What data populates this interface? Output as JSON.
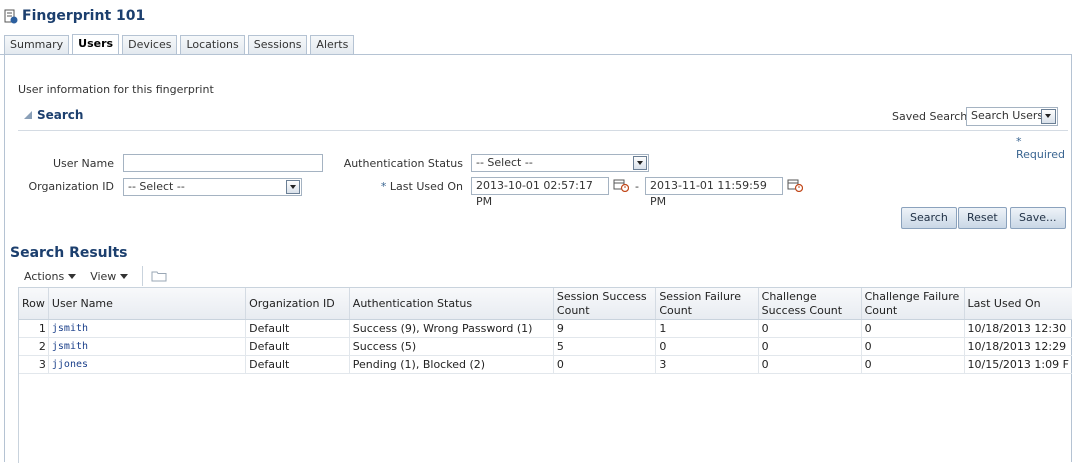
{
  "title": "Fingerprint 101",
  "tabs": [
    {
      "label": "Summary"
    },
    {
      "label": "Users"
    },
    {
      "label": "Devices"
    },
    {
      "label": "Locations"
    },
    {
      "label": "Sessions"
    },
    {
      "label": "Alerts"
    }
  ],
  "active_tab": "Users",
  "intro": "User information for this fingerprint",
  "search": {
    "heading": "Search",
    "saved_search_label": "Saved Search",
    "saved_search_value": "Search Users",
    "required_star": "*",
    "required_label": "Required",
    "user_name_label": "User Name",
    "user_name_value": "",
    "org_id_label": "Organization ID",
    "org_id_value": "-- Select --",
    "auth_status_label": "Authentication Status",
    "auth_status_value": "-- Select --",
    "last_used_star": "*",
    "last_used_label": "Last Used On",
    "date_from": "2013-10-01 02:57:17 PM",
    "date_sep": "-",
    "date_to": "2013-11-01 11:59:59 PM",
    "buttons": {
      "search": "Search",
      "reset": "Reset",
      "save": "Save..."
    }
  },
  "results": {
    "heading": "Search Results",
    "toolbar": {
      "actions": "Actions",
      "view": "View"
    },
    "columns": [
      "Row",
      "User Name",
      "Organization ID",
      "Authentication Status",
      "Session Success Count",
      "Session Failure Count",
      "Challenge Success Count",
      "Challenge Failure Count",
      "Last Used On"
    ],
    "rows": [
      {
        "row": "1",
        "user": "jsmith",
        "org": "Default",
        "auth": "Success (9), Wrong Password (1)",
        "ss": "9",
        "sf": "1",
        "cs": "0",
        "cf": "0",
        "last": "10/18/2013 12:30"
      },
      {
        "row": "2",
        "user": "jsmith",
        "org": "Default",
        "auth": "Success (5)",
        "ss": "5",
        "sf": "0",
        "cs": "0",
        "cf": "0",
        "last": "10/18/2013 12:29"
      },
      {
        "row": "3",
        "user": "jjones",
        "org": "Default",
        "auth": "Pending (1), Blocked (2)",
        "ss": "0",
        "sf": "3",
        "cs": "0",
        "cf": "0",
        "last": "10/15/2013 1:09 F"
      }
    ]
  },
  "colors": {
    "accent": "#1c3f6e",
    "border": "#b5c3d3",
    "link": "#1a3f8a"
  },
  "icons": [
    "fingerprint-page-icon",
    "collapse-triangle-icon",
    "dropdown-arrow-icon",
    "calendar-icon",
    "folder-icon",
    "chevron-down-icon"
  ]
}
